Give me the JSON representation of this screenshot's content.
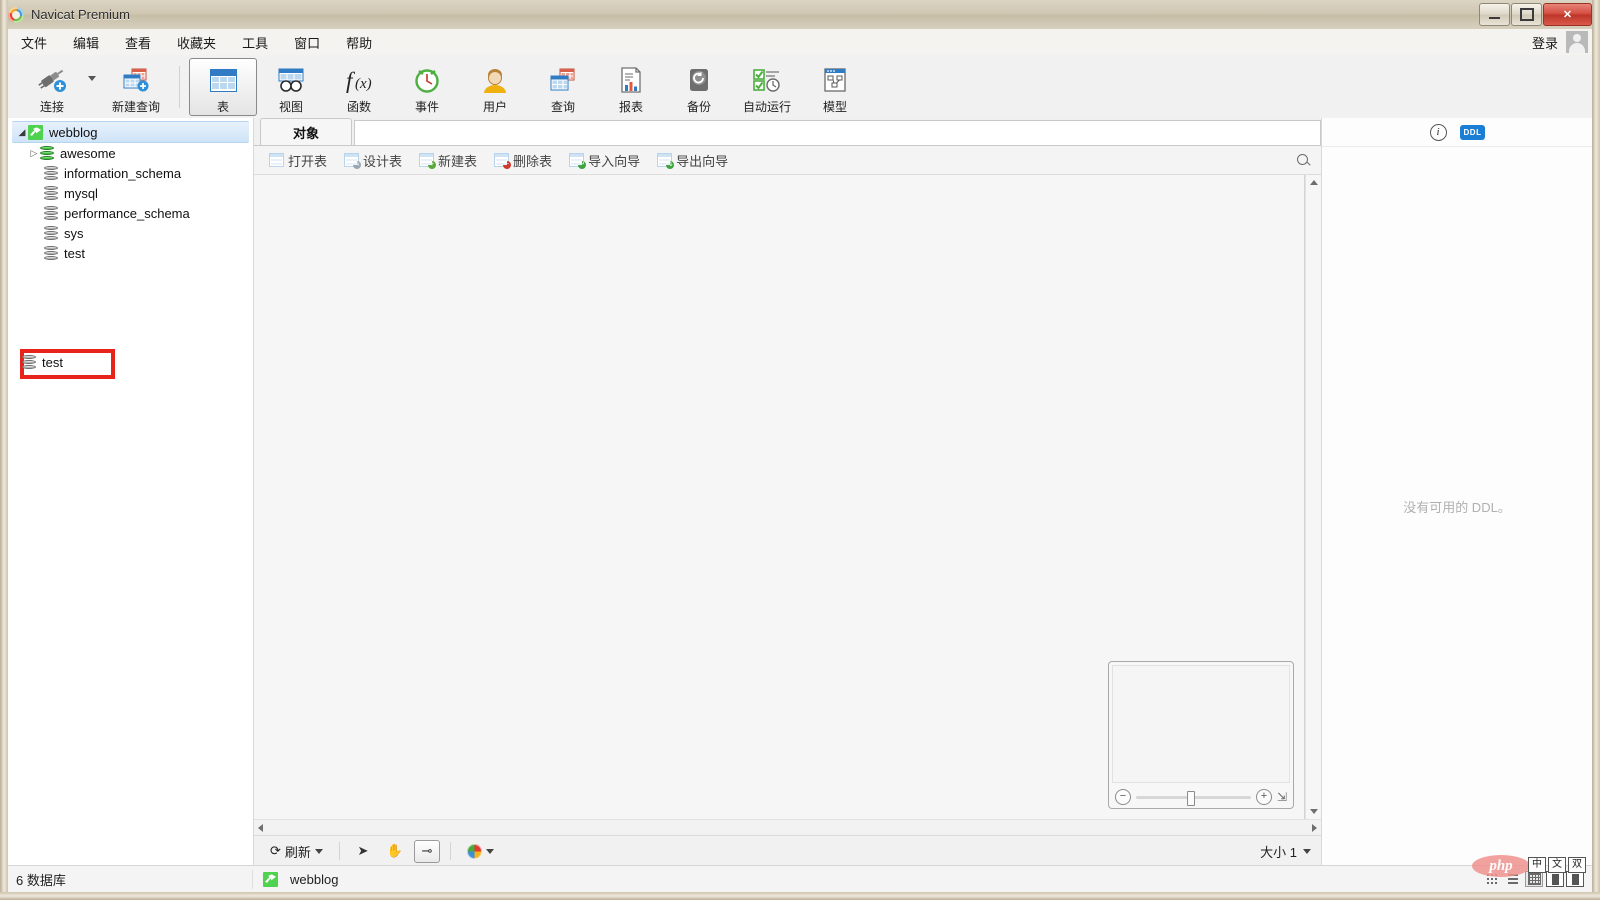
{
  "window": {
    "title": "Navicat Premium",
    "logo_icon": "navicat-logo-icon",
    "minimize_icon": "minimize-icon",
    "maximize_icon": "maximize-icon",
    "close_icon": "close-icon"
  },
  "menubar": {
    "items": [
      {
        "label": "文件"
      },
      {
        "label": "编辑"
      },
      {
        "label": "查看"
      },
      {
        "label": "收藏夹"
      },
      {
        "label": "工具"
      },
      {
        "label": "窗口"
      },
      {
        "label": "帮助"
      }
    ],
    "login_label": "登录",
    "avatar_icon": "user-avatar-icon"
  },
  "toolbar": {
    "items": [
      {
        "label": "连接",
        "icon": "connection-plug-icon"
      },
      {
        "label": "新建查询",
        "icon": "new-query-icon"
      },
      {
        "label": "表",
        "icon": "table-icon",
        "selected": true
      },
      {
        "label": "视图",
        "icon": "view-icon"
      },
      {
        "label": "函数",
        "icon": "function-fx-icon"
      },
      {
        "label": "事件",
        "icon": "event-clock-icon"
      },
      {
        "label": "用户",
        "icon": "user-icon"
      },
      {
        "label": "查询",
        "icon": "query-icon"
      },
      {
        "label": "报表",
        "icon": "report-icon"
      },
      {
        "label": "备份",
        "icon": "backup-icon"
      },
      {
        "label": "自动运行",
        "icon": "automation-icon"
      },
      {
        "label": "模型",
        "icon": "model-icon"
      }
    ]
  },
  "sidebar": {
    "connection": {
      "label": "webblog",
      "icon": "mysql-connection-icon",
      "selected": true,
      "expanded": true
    },
    "databases": [
      {
        "label": "awesome",
        "icon": "database-icon",
        "color": "green",
        "expandable": true
      },
      {
        "label": "information_schema",
        "icon": "database-icon",
        "color": "grey",
        "expandable": false
      },
      {
        "label": "mysql",
        "icon": "database-icon",
        "color": "grey",
        "expandable": false
      },
      {
        "label": "performance_schema",
        "icon": "database-icon",
        "color": "grey",
        "expandable": false
      },
      {
        "label": "sys",
        "icon": "database-icon",
        "color": "grey",
        "expandable": false
      },
      {
        "label": "test",
        "icon": "database-icon",
        "color": "grey",
        "expandable": false,
        "annotated": true
      }
    ],
    "annotation_color": "#e8231c"
  },
  "center": {
    "tab": {
      "label": "对象"
    },
    "object_toolbar": [
      {
        "label": "打开表",
        "icon": "open-table-icon"
      },
      {
        "label": "设计表",
        "icon": "design-table-icon"
      },
      {
        "label": "新建表",
        "icon": "new-table-icon"
      },
      {
        "label": "删除表",
        "icon": "delete-table-icon"
      },
      {
        "label": "导入向导",
        "icon": "import-wizard-icon"
      },
      {
        "label": "导出向导",
        "icon": "export-wizard-icon"
      }
    ],
    "search_icon": "search-icon",
    "minimap": {
      "zoom_out_icon": "zoom-out-icon",
      "zoom_in_icon": "zoom-in-icon",
      "expand_icon": "expand-diagonal-icon",
      "zoom_value": 44
    },
    "bottom_bar": {
      "refresh_label": "刷新",
      "refresh_icon": "refresh-icon",
      "dropdown_icon": "chevron-down-icon",
      "pointer_icon": "pointer-tool-icon",
      "hand_icon": "hand-tool-icon",
      "link_icon": "relation-tool-icon",
      "color_icon": "color-wheel-icon",
      "size_label": "大小 1"
    }
  },
  "right_panel": {
    "info_icon": "info-icon",
    "ddl_icon": "ddl-icon",
    "ddl_badge_text": "DDL",
    "empty_message": "没有可用的 DDL。"
  },
  "statusbar": {
    "left_text": "6 数据库",
    "connection_label": "webblog",
    "connection_icon": "mysql-connection-icon",
    "view_icons": [
      {
        "name": "detail-view-icon",
        "active": false
      },
      {
        "name": "list-view-icon",
        "active": false
      },
      {
        "name": "grid-view-icon",
        "active": true
      }
    ],
    "watermark": "php",
    "ime": [
      "中",
      "文",
      "双"
    ]
  }
}
